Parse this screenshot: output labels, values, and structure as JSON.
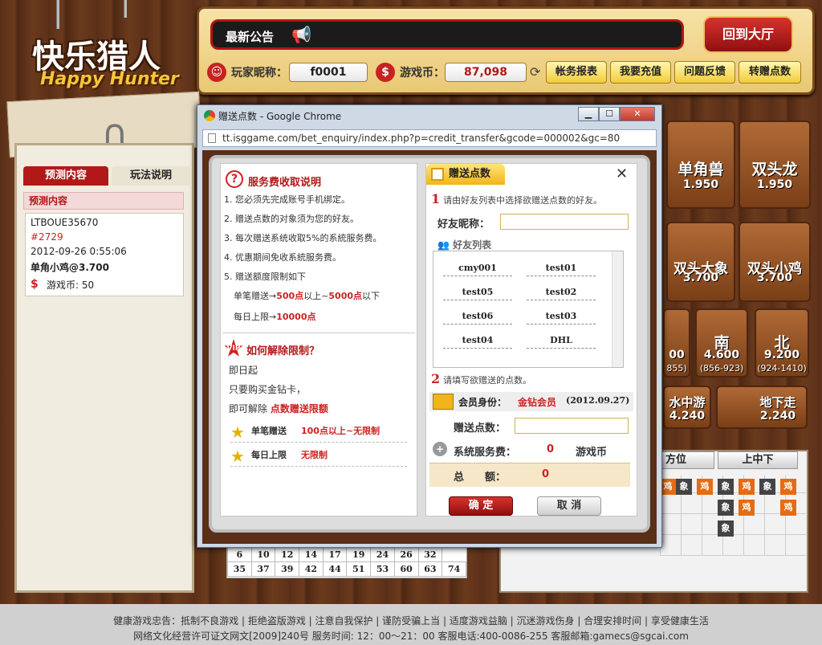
{
  "logo": {
    "cn": "快乐猎人",
    "en": "Happy Hunter"
  },
  "notice": {
    "label": "最新公告",
    "text": ""
  },
  "lobby_button": "回到大厅",
  "user": {
    "nick_label": "玩家昵称：",
    "nick": "f0001",
    "coin_label": "游戏币：",
    "coins": "87,098"
  },
  "topnav": [
    "帐务报表",
    "我要充值",
    "问题反馈",
    "转赠点数"
  ],
  "leftpanel": {
    "tabs": [
      "预测内容",
      "玩法说明"
    ],
    "header": "预测内容",
    "record": {
      "id": "LTBOUE35670",
      "round": "#2729",
      "time": "2012-09-26 0:55:06",
      "bet": "单角小鸡@3.700",
      "coin_label": "游戏币: 50"
    }
  },
  "tiles": [
    {
      "name": "单角兽",
      "odds": "1.950",
      "range": ""
    },
    {
      "name": "双头龙",
      "odds": "1.950",
      "range": ""
    },
    {
      "name": "双头大象",
      "odds": "3.700",
      "range": ""
    },
    {
      "name": "双头小鸡",
      "odds": "3.700",
      "range": ""
    },
    {
      "name": "",
      "odds": "00",
      "range": "855)"
    },
    {
      "name": "南",
      "odds": "4.600",
      "range": "(856-923)"
    },
    {
      "name": "北",
      "odds": "9.200",
      "range": "(924-1410)"
    },
    {
      "name": "水中游",
      "odds": "4.240",
      "range": ""
    },
    {
      "name": "地下走",
      "odds": "2.240",
      "range": ""
    }
  ],
  "numgrid": {
    "rows": [
      [
        "6",
        "10",
        "12",
        "14",
        "17",
        "19",
        "24",
        "26",
        "32"
      ],
      [
        "35",
        "37",
        "39",
        "42",
        "44",
        "51",
        "53",
        "60",
        "63",
        "74"
      ]
    ]
  },
  "results": {
    "headers": [
      "方位",
      "上中下"
    ],
    "chips": [
      "象",
      "鸡",
      "象",
      "鸡",
      "象",
      "鸡",
      "象",
      "鸡",
      "象",
      "鸡",
      "象"
    ]
  },
  "footer": {
    "line1": "健康游戏忠告：抵制不良游戏 | 拒绝盗版游戏 | 注意自我保护 | 谨防受骗上当 | 适度游戏益脑 | 沉迷游戏伤身 | 合理安排时间 | 享受健康生活",
    "line2": "网络文化经营许可证文网文[2009]240号  服务时间: 12：00～21：00 客服电话:400-0086-255  客服邮箱:gamecs@sgcai.com"
  },
  "window": {
    "title": "赠送点数 - Google Chrome",
    "url": "tt.isggame.com/bet_enquiry/index.php?p=credit_transfer&gcode=000002&gc=80",
    "controls": [
      "▁",
      "☐",
      "✕"
    ]
  },
  "dialog": {
    "fee_title": "服务费收取说明",
    "rules": [
      "1. 您必须先完成账号手机绑定。",
      "2. 赠送点数的对象须为您的好友。",
      "3. 每次赠送系统收取5%的系統服务费。",
      "4. 优惠期间免收系統服务费。",
      "5. 赠送额度限制如下"
    ],
    "limit_single": {
      "prefix": "单笔赠送→",
      "min": "500点",
      "mid": "以上~",
      "max": "5000点",
      "suffix": "以下"
    },
    "limit_daily": {
      "prefix": "每日上限→",
      "value": "10000点"
    },
    "unlock_title": "如何解除限制？",
    "unlock_lines": [
      "即日起",
      "只要购买金钻卡，",
      "即可解除"
    ],
    "unlock_highlight": "点数赠送限额",
    "perk1_label": "单笔赠送",
    "perk1_value": "100点以上~无限制",
    "perk2_label": "每日上限",
    "perk2_value": "无限制",
    "tab": "赠送点数",
    "close": "✕",
    "step1": "请由好友列表中选择欲赠送点数的好友。",
    "friend_label": "好友昵称：",
    "friend_value": "",
    "friend_list_title": "好友列表",
    "friends": [
      "cmy001",
      "test01",
      "test05",
      "test02",
      "test06",
      "test03",
      "test04",
      "DHL"
    ],
    "step2": "请填写欲赠送的点数。",
    "member_label": "会员身份：",
    "member_value": "金钻会员",
    "member_date": "(2012.09.27)",
    "amount_label": "赠送点数：",
    "amount_value": "",
    "fee_label": "系统服务费：",
    "fee_value": "0",
    "fee_unit": "游戏币",
    "total_label": "总　　额：",
    "total_value": "0",
    "ok": "确 定",
    "cancel": "取 消"
  }
}
